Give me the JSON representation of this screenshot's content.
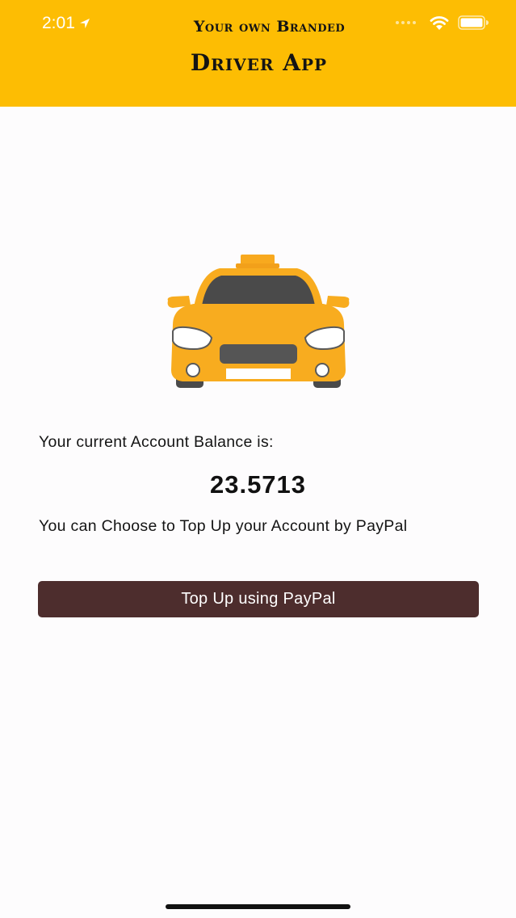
{
  "status_bar": {
    "time": "2:01",
    "icons": [
      "location-arrow-icon",
      "signal-dots-icon",
      "wifi-icon",
      "battery-icon"
    ]
  },
  "header": {
    "line1": "Your own Branded",
    "line2": "Driver App",
    "background_color": "#fdbd03"
  },
  "illustration": {
    "icon": "taxi-icon"
  },
  "account": {
    "balance_label": "Your current Account Balance is:",
    "balance_value": "23.5713",
    "topup_text": "You can Choose to Top Up your Account by PayPal"
  },
  "topup_button": {
    "label": "Top Up using PayPal",
    "color": "#4d2d2d"
  }
}
